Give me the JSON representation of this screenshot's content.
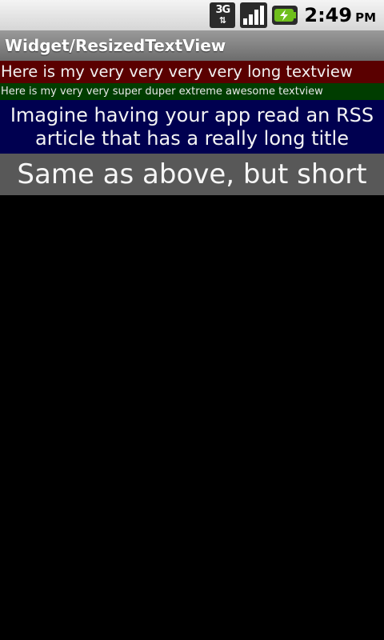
{
  "status_bar": {
    "network_label": "3G",
    "time": "2:49",
    "ampm": "PM",
    "icons": [
      "network-3g-icon",
      "signal-strength-icon",
      "battery-charging-icon"
    ],
    "battery_color": "#6fbf1c"
  },
  "title_bar": {
    "title": "Widget/ResizedTextView"
  },
  "rows": [
    {
      "text": "Here is my very very very very long textview",
      "background": "#5a0000"
    },
    {
      "text": "Here is my very very super duper extreme awesome textview",
      "background": "#003d00"
    },
    {
      "text": "Imagine having your app read an RSS article that has a really long title",
      "background": "#000050"
    },
    {
      "text": "Same as above, but short",
      "background": "#585858"
    }
  ]
}
